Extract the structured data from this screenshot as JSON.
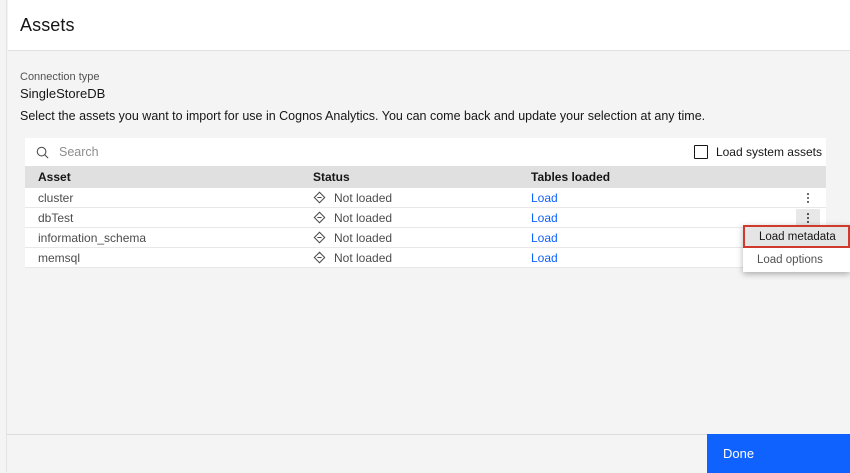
{
  "panel": {
    "title": "Assets"
  },
  "connection": {
    "label": "Connection type",
    "value": "SingleStoreDB"
  },
  "description": "Select the assets you want to import for use in Cognos Analytics. You can come back and update your selection at any time.",
  "toolbar": {
    "search_placeholder": "Search",
    "checkbox_label": "Load system assets",
    "checkbox_checked": false
  },
  "table": {
    "columns": [
      "Asset",
      "Status",
      "Tables loaded"
    ],
    "rows": [
      {
        "asset": "cluster",
        "status": "Not loaded",
        "action": "Load"
      },
      {
        "asset": "dbTest",
        "status": "Not loaded",
        "action": "Load"
      },
      {
        "asset": "information_schema",
        "status": "Not loaded",
        "action": "Load"
      },
      {
        "asset": "memsql",
        "status": "Not loaded",
        "action": "Load"
      }
    ]
  },
  "context_menu": {
    "items": [
      {
        "label": "Load metadata",
        "highlighted": true
      },
      {
        "label": "Load options",
        "highlighted": false
      }
    ]
  },
  "footer": {
    "done_label": "Done"
  },
  "colors": {
    "accent_blue": "#0f62fe",
    "link_blue": "#0f62fe",
    "annotation_red": "#cf3a2c",
    "table_header_gray": "#e0e0e0",
    "body_gray": "#f4f4f4",
    "menu_highlight_gray": "#e5e5e5"
  }
}
